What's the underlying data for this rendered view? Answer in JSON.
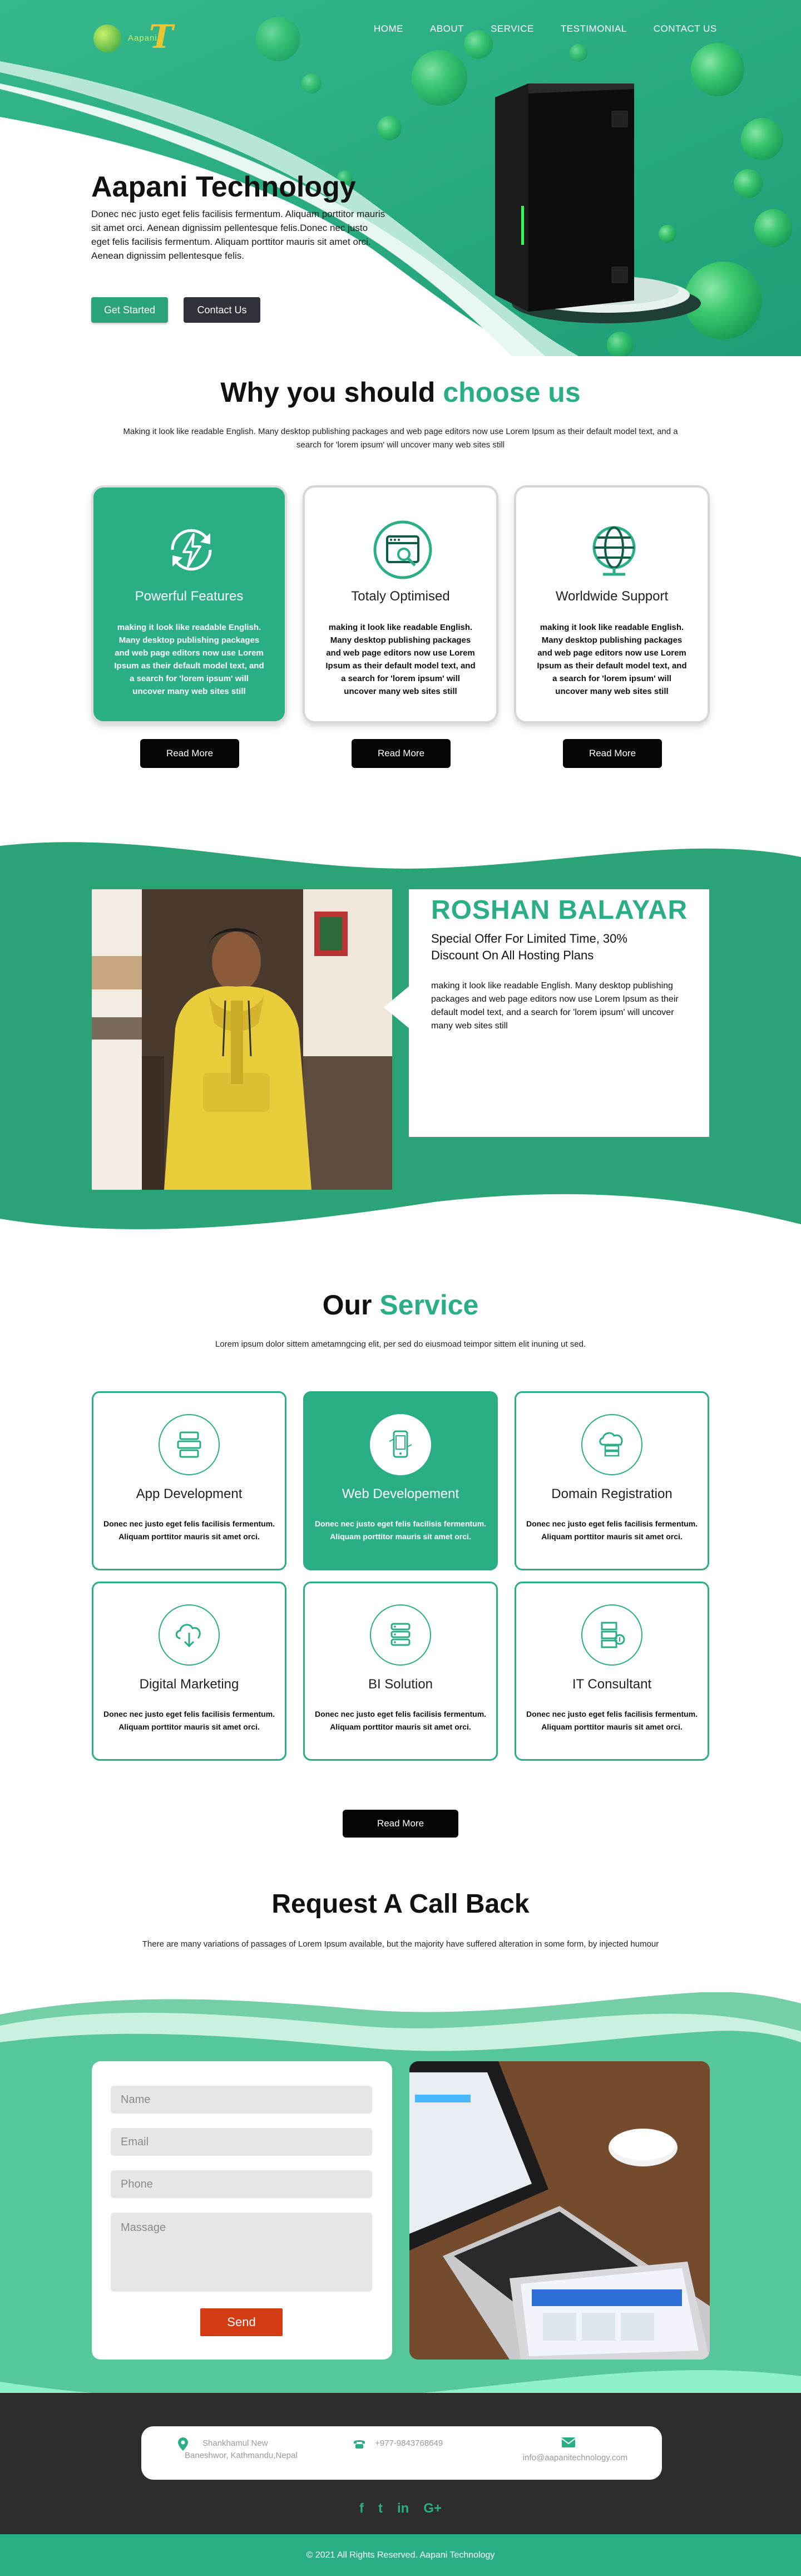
{
  "nav": {
    "logo_text": "Aapani",
    "logo_letter": "T",
    "items": [
      "HOME",
      "ABOUT",
      "SERVICE",
      "TESTIMONIAL",
      "CONTACT US"
    ]
  },
  "hero": {
    "title": "Aapani Technology",
    "text": "Donec nec justo eget felis facilisis fermentum. Aliquam porttitor mauris sit amet orci. Aenean dignissim pellentesque felis.Donec nec justo eget felis facilisis fermentum. Aliquam porttitor mauris sit amet orci. Aenean dignissim pellentesque felis.",
    "primary_button": "Get Started",
    "secondary_button": "Contact Us"
  },
  "why": {
    "title_main": "Why you should ",
    "title_accent": "choose us",
    "subtitle": "Making it look like readable English. Many desktop publishing packages and web page editors now use Lorem Ipsum as their default model text, and a search for 'lorem ipsum' will uncover many web sites still",
    "cards": [
      {
        "title": "Powerful Features",
        "text": "making it look like readable English. Many desktop publishing packages and web page editors now use Lorem Ipsum as their default model text, and a search for 'lorem ipsum' will uncover many web sites still",
        "icon": "lightning-refresh-icon",
        "button": "Read More"
      },
      {
        "title": "Totaly Optimised",
        "text": "making it look like readable English. Many desktop publishing packages and web page editors now use Lorem Ipsum as their default model text, and a search for 'lorem ipsum' will uncover many web sites still",
        "icon": "browser-search-icon",
        "button": "Read More"
      },
      {
        "title": "Worldwide Support",
        "text": "making it look like readable English. Many desktop publishing packages and web page editors now use Lorem Ipsum as their default model text, and a search for 'lorem ipsum' will uncover many web sites still",
        "icon": "globe-icon",
        "button": "Read More"
      }
    ]
  },
  "about": {
    "name": "ROSHAN BALAYAR",
    "offer": "Special Offer For Limited Time, 30% Discount On All Hosting Plans",
    "text": "making it look like readable English. Many desktop publishing packages and web page editors now use Lorem Ipsum as their default model text, and a search for 'lorem ipsum' will uncover many web sites still"
  },
  "service": {
    "title_main": "Our ",
    "title_accent": "Service",
    "subtitle": "Lorem ipsum dolor sittem ametamngcing elit, per sed do eiusmoad teimpor sittem elit inuning ut sed.",
    "cards": [
      {
        "title": "App Development",
        "text": "Donec nec justo eget felis facilisis fermentum. Aliquam porttitor mauris sit amet orci.",
        "icon": "app-stack-icon"
      },
      {
        "title": "Web Developement",
        "text": "Donec nec justo eget felis facilisis fermentum. Aliquam porttitor mauris sit amet orci.",
        "icon": "mobile-web-icon"
      },
      {
        "title": "Domain Registration",
        "text": "Donec nec justo eget felis facilisis fermentum. Aliquam porttitor mauris sit amet orci.",
        "icon": "cloud-server-icon"
      },
      {
        "title": "Digital Marketing",
        "text": "Donec nec justo eget felis facilisis fermentum. Aliquam porttitor mauris sit amet orci.",
        "icon": "cloud-download-icon"
      },
      {
        "title": "BI Solution",
        "text": "Donec nec justo eget felis facilisis fermentum. Aliquam porttitor mauris sit amet orci.",
        "icon": "database-icon"
      },
      {
        "title": "IT Consultant",
        "text": "Donec nec justo eget felis facilisis fermentum. Aliquam porttitor mauris sit amet orci.",
        "icon": "server-rack-icon"
      }
    ],
    "button": "Read More"
  },
  "callback": {
    "title": "Request A Call Back",
    "subtitle": "There are many variations of passages of Lorem Ipsum available, but the majority have suffered alteration in some form, by injected humour",
    "name_placeholder": "Name",
    "email_placeholder": "Email",
    "phone_placeholder": "Phone",
    "message_placeholder": "Massage",
    "send_button": "Send"
  },
  "footer": {
    "address_line1": "Shankhamul New",
    "address_line2": "Baneshwor, Kathmandu,Nepal",
    "phone": "+977-9843768649",
    "email": "info@aapanitechnology.com",
    "socials": [
      "f",
      "t",
      "in",
      "G+"
    ],
    "copyright": "© 2021 All Rights Reserved. Aapani Technology"
  },
  "colors": {
    "accent": "#2aae85",
    "dark": "#2d2d2d",
    "send": "#d33b12"
  }
}
